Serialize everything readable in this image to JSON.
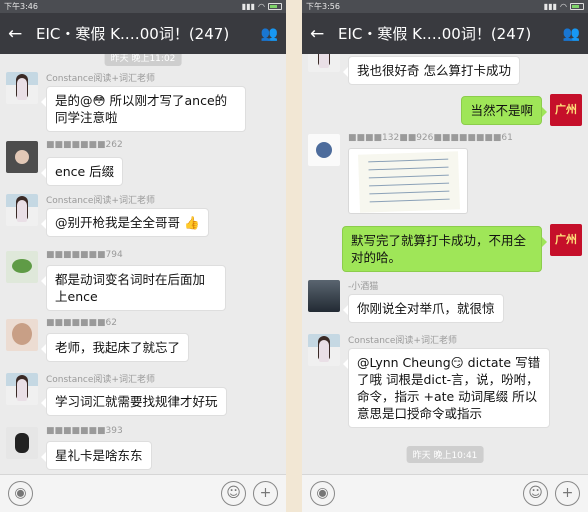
{
  "left": {
    "status": {
      "time": "下午3:46"
    },
    "header": {
      "title": "EIC・寒假 K.…00词！(247)"
    },
    "timestamp": "昨天 晚上11:02",
    "messages": [
      {
        "name": "Constance阅读+词汇老师",
        "text": "是的@😳  所以刚才写了ance的同学注意啦"
      },
      {
        "name": "■■■■■■■262",
        "text": "ence 后缀"
      },
      {
        "name": "Constance阅读+词汇老师",
        "text": "@别开枪我是全全哥哥 👍"
      },
      {
        "name": "■■■■■■■794",
        "text": "都是动词变名词时在后面加上ence"
      },
      {
        "name": "■■■■■■■62",
        "text": "老师，我起床了就忘了"
      },
      {
        "name": "Constance阅读+词汇老师",
        "text": "学习词汇就需要找规律才好玩"
      },
      {
        "name": "■■■■■■■393",
        "text": "星礼卡是啥东东"
      }
    ]
  },
  "right": {
    "status": {
      "time": "下午3:56"
    },
    "header": {
      "title": "EIC・寒假 K.…00词！(247)"
    },
    "timestamp": "昨天 晚上10:41",
    "messages": [
      {
        "name": "",
        "text": "我也很好奇 怎么算打卡成功"
      },
      {
        "name": "",
        "text": "当然不是啊",
        "avatar": "广州"
      },
      {
        "name": "■■■■132■■926■■■■■■■■61",
        "text": ""
      },
      {
        "name": "",
        "text": "默写完了就算打卡成功，不用全对的哈。",
        "avatar": "广州"
      },
      {
        "name": "-小酒猫",
        "text": "你刚说全对举爪，就很惊"
      },
      {
        "name": "Constance阅读+词汇老师",
        "text": "@Lynn Cheung😏 dictate 写错了哦  词根是dict-言，说，吩咐，命令，指示 +ate 动词尾缀  所以意思是口授命令或指示"
      }
    ]
  }
}
